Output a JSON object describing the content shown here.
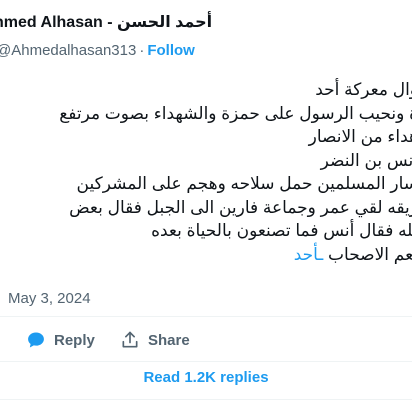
{
  "author": {
    "display_name": "hmed Alhasan - أحمد الحسن",
    "handle": "@Ahmedalhasan313",
    "separator": "·",
    "follow_label": "Follow"
  },
  "tweet": {
    "lines": [
      "وال معركة أحد",
      "ة ونحيب الرسول على حمزة والشهداء بصوت مرتفع",
      "هداء من الانصار",
      "أنس بن النضر",
      "سار المسلمين حمل سلاحه وهجم على المشركين",
      "ريقه لقي عمر وجماعة فارين الى الجبل فقال بعض",
      "لله فقال أنس فما تصنعون بالحياة بعده"
    ],
    "last_line_hashtag": "ـأحد",
    "last_line_text": "نعم الاصحاب",
    "date": "May 3, 2024"
  },
  "actions": {
    "reply_label": "Reply",
    "share_label": "Share",
    "read_replies_label": "Read 1.2K replies"
  },
  "colors": {
    "accent": "#1d9bf0",
    "muted": "#536471",
    "text": "#0f1419",
    "divider": "#eff3f4"
  },
  "icons": {
    "reply": "speech-bubble-icon",
    "share": "share-arrow-icon"
  }
}
